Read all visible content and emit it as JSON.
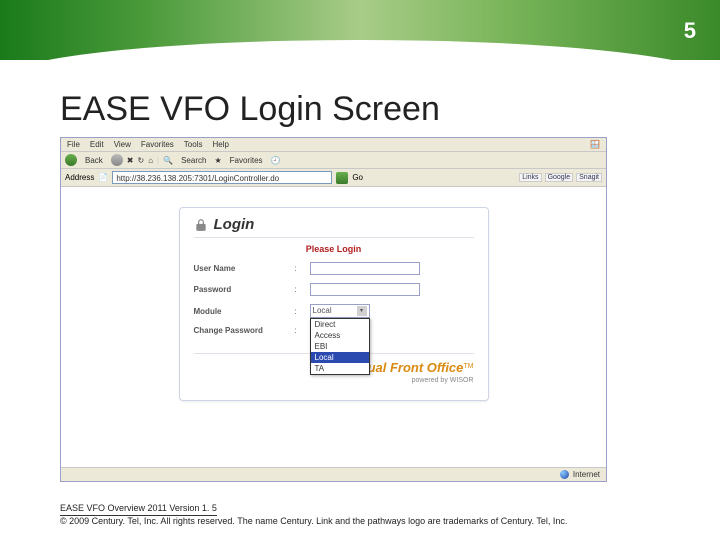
{
  "slide_number": "5",
  "slide_title": "EASE VFO Login Screen",
  "browser": {
    "menu": [
      "File",
      "Edit",
      "View",
      "Favorites",
      "Tools",
      "Help"
    ],
    "toolbar": {
      "back": "Back",
      "search": "Search",
      "favorites": "Favorites"
    },
    "address_label": "Address",
    "address_value": "http://38.236.138.205:7301/LoginController.do",
    "go": "Go",
    "links": [
      "Links",
      "Google",
      "Snagit"
    ],
    "status": "Internet"
  },
  "login": {
    "heading": "Login",
    "please": "Please Login",
    "fields": {
      "username_label": "User Name",
      "password_label": "Password",
      "module_label": "Module",
      "change_pw_label": "Change Password"
    },
    "module_selected": "Local",
    "module_options": [
      "Direct",
      "Access",
      "EBI",
      "Local",
      "TA"
    ],
    "brand": "Virtual Front Office",
    "brand_tm": "TM",
    "powered": "powered by WISOR"
  },
  "footer": {
    "line1": "EASE VFO Overview 2011 Version 1. 5",
    "line2": "© 2009 Century. Tel, Inc. All rights reserved. The name Century. Link and the pathways logo are trademarks of Century. Tel, Inc."
  }
}
